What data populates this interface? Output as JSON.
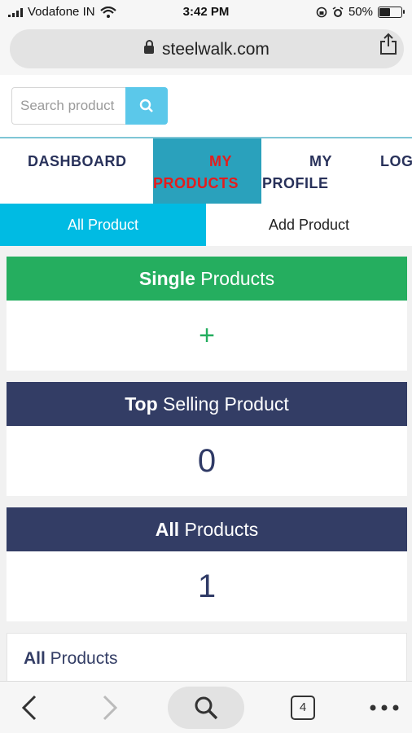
{
  "status_bar": {
    "carrier": "Vodafone IN",
    "time": "3:42 PM",
    "battery": "50%",
    "battery_level": 0.5
  },
  "browser": {
    "url": "steelwalk.com"
  },
  "search": {
    "placeholder": "Search product"
  },
  "nav": {
    "dashboard": "DASHBOARD",
    "my_products_1": "MY",
    "my_products_2": "PRODUCTS",
    "my_profile_1": "MY",
    "my_profile_2": "PROFILE",
    "logout": "LOG"
  },
  "subtabs": {
    "all_product": "All Product",
    "add_product": "Add Product"
  },
  "cards": [
    {
      "bold": "Single",
      "rest": " Products",
      "value": "+"
    },
    {
      "bold": "Top",
      "rest": " Selling Product",
      "value": "0"
    },
    {
      "bold": "All",
      "rest": " Products",
      "value": "1"
    }
  ],
  "list_card": {
    "bold": "All",
    "rest": " Products"
  },
  "toolbar": {
    "tab_count": "4"
  },
  "colors": {
    "accent_cyan": "#00bbe3",
    "nav_active_bg": "#2aa1bc",
    "nav_active_text": "#e51c1c",
    "green": "#25ae5f",
    "navy": "#333d65"
  }
}
